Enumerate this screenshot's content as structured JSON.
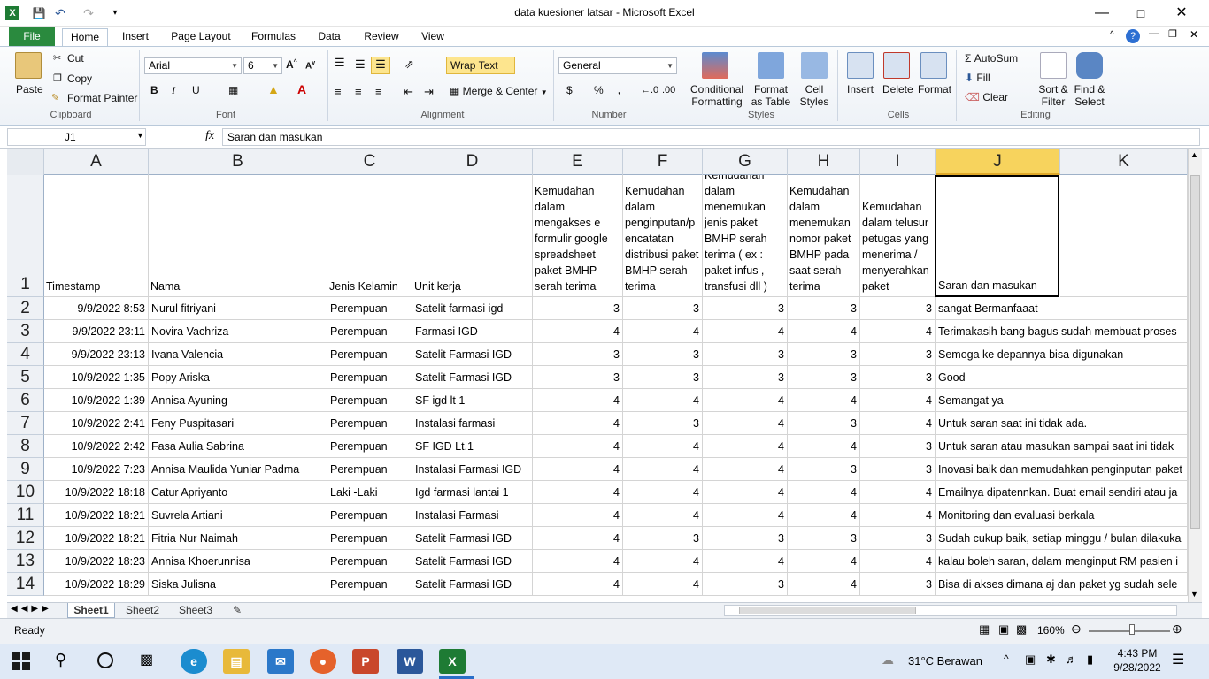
{
  "window": {
    "title": "data kuesioner latsar  -  Microsoft Excel"
  },
  "tabs": [
    "File",
    "Home",
    "Insert",
    "Page Layout",
    "Formulas",
    "Data",
    "Review",
    "View"
  ],
  "active_tab": "Home",
  "ribbon": {
    "clipboard": {
      "paste": "Paste",
      "cut": "Cut",
      "copy": "Copy",
      "format_painter": "Format Painter",
      "label": "Clipboard"
    },
    "font": {
      "name": "Arial",
      "size": "6",
      "bold": "B",
      "italic": "I",
      "underline": "U",
      "label": "Font"
    },
    "alignment": {
      "wrap_text": "Wrap Text",
      "merge_center": "Merge & Center",
      "label": "Alignment"
    },
    "number": {
      "format": "General",
      "currency": "$",
      "percent": "%",
      "comma": ",",
      "label": "Number"
    },
    "styles": {
      "conditional": "Conditional",
      "conditional2": "Formatting",
      "format_table": "Format",
      "format_table2": "as Table",
      "cell_styles": "Cell",
      "cell_styles2": "Styles",
      "label": "Styles"
    },
    "cells": {
      "insert": "Insert",
      "delete": "Delete",
      "format": "Format",
      "label": "Cells"
    },
    "editing": {
      "autosum": "AutoSum",
      "fill": "Fill",
      "clear": "Clear",
      "sort": "Sort &",
      "sort2": "Filter",
      "find": "Find &",
      "find2": "Select",
      "label": "Editing"
    }
  },
  "formula_bar": {
    "name_box": "J1",
    "fx": "fx",
    "content": "Saran dan masukan"
  },
  "columns": [
    "A",
    "B",
    "C",
    "D",
    "E",
    "F",
    "G",
    "H",
    "I",
    "J",
    "K"
  ],
  "header_row": {
    "A": "Timestamp",
    "B": "Nama",
    "C": "Jenis Kelamin",
    "D": "Unit kerja",
    "E": "Kemudahan dalam mengakses e formulir google spreadsheet paket BMHP serah terima",
    "F": "Kemudahan dalam penginputan/p encatatan distribusi paket BMHP serah terima",
    "G": "Kemudahan dalam menemukan jenis paket BMHP serah terima ( ex : paket infus , transfusi dll )",
    "H": "Kemudahan dalam menemukan nomor paket BMHP pada saat serah terima",
    "I": "Kemudahan dalam telusur petugas yang menerima / menyerahkan paket",
    "J": "Saran dan masukan"
  },
  "rows": [
    {
      "n": "2",
      "A": "9/9/2022 8:53",
      "B": "Nurul fitriyani",
      "C": "Perempuan",
      "D": "Satelit farmasi igd",
      "E": "3",
      "F": "3",
      "G": "3",
      "H": "3",
      "I": "3",
      "J": "sangat Bermanfaaat"
    },
    {
      "n": "3",
      "A": "9/9/2022 23:11",
      "B": "Novira Vachriza",
      "C": "Perempuan",
      "D": "Farmasi IGD",
      "E": "4",
      "F": "4",
      "G": "4",
      "H": "4",
      "I": "4",
      "J": "Terimakasih bang bagus sudah membuat proses"
    },
    {
      "n": "4",
      "A": "9/9/2022 23:13",
      "B": "Ivana Valencia",
      "C": "Perempuan",
      "D": "Satelit Farmasi IGD",
      "E": "3",
      "F": "3",
      "G": "3",
      "H": "3",
      "I": "3",
      "J": "Semoga ke depannya bisa digunakan"
    },
    {
      "n": "5",
      "A": "10/9/2022 1:35",
      "B": "Popy Ariska",
      "C": "Perempuan",
      "D": "Satelit Farmasi IGD",
      "E": "3",
      "F": "3",
      "G": "3",
      "H": "3",
      "I": "3",
      "J": "Good"
    },
    {
      "n": "6",
      "A": "10/9/2022 1:39",
      "B": "Annisa Ayuning",
      "C": "Perempuan",
      "D": "SF igd lt 1",
      "E": "4",
      "F": "4",
      "G": "4",
      "H": "4",
      "I": "4",
      "J": "Semangat ya"
    },
    {
      "n": "7",
      "A": "10/9/2022 2:41",
      "B": "Feny Puspitasari",
      "C": "Perempuan",
      "D": "Instalasi farmasi",
      "E": "4",
      "F": "3",
      "G": "4",
      "H": "3",
      "I": "4",
      "J": "Untuk saran saat ini tidak ada."
    },
    {
      "n": "8",
      "A": "10/9/2022 2:42",
      "B": "Fasa Aulia Sabrina",
      "C": "Perempuan",
      "D": "SF IGD Lt.1",
      "E": "4",
      "F": "4",
      "G": "4",
      "H": "4",
      "I": "3",
      "J": "Untuk saran atau masukan sampai saat ini tidak"
    },
    {
      "n": "9",
      "A": "10/9/2022 7:23",
      "B": "Annisa Maulida Yuniar Padma",
      "C": "Perempuan",
      "D": "Instalasi Farmasi IGD",
      "E": "4",
      "F": "4",
      "G": "4",
      "H": "3",
      "I": "3",
      "J": "Inovasi baik dan memudahkan penginputan paket"
    },
    {
      "n": "10",
      "A": "10/9/2022 18:18",
      "B": "Catur Apriyanto",
      "C": "Laki -Laki",
      "D": "Igd farmasi lantai 1",
      "E": "4",
      "F": "4",
      "G": "4",
      "H": "4",
      "I": "4",
      "J": "Emailnya dipatennkan. Buat email sendiri atau ja"
    },
    {
      "n": "11",
      "A": "10/9/2022 18:21",
      "B": "Suvrela Artiani",
      "C": "Perempuan",
      "D": "Instalasi Farmasi",
      "E": "4",
      "F": "4",
      "G": "4",
      "H": "4",
      "I": "4",
      "J": "Monitoring dan evaluasi berkala"
    },
    {
      "n": "12",
      "A": "10/9/2022 18:21",
      "B": "Fitria Nur Naimah",
      "C": "Perempuan",
      "D": "Satelit Farmasi IGD",
      "E": "4",
      "F": "3",
      "G": "3",
      "H": "3",
      "I": "3",
      "J": "Sudah cukup baik, setiap minggu / bulan dilakuka"
    },
    {
      "n": "13",
      "A": "10/9/2022 18:23",
      "B": "Annisa Khoerunnisa",
      "C": "Perempuan",
      "D": "Satelit Farmasi IGD",
      "E": "4",
      "F": "4",
      "G": "4",
      "H": "4",
      "I": "4",
      "J": "kalau boleh saran, dalam menginput RM pasien i"
    },
    {
      "n": "14",
      "A": "10/9/2022 18:29",
      "B": "Siska Julisna",
      "C": "Perempuan",
      "D": "Satelit Farmasi IGD",
      "E": "4",
      "F": "4",
      "G": "3",
      "H": "4",
      "I": "3",
      "J": "Bisa di akses dimana aj dan paket yg sudah sele"
    }
  ],
  "sheets": [
    "Sheet1",
    "Sheet2",
    "Sheet3"
  ],
  "status": {
    "ready": "Ready",
    "zoom": "160%"
  },
  "taskbar": {
    "weather": "31°C  Berawan",
    "time": "4:43 PM",
    "date": "9/28/2022"
  }
}
